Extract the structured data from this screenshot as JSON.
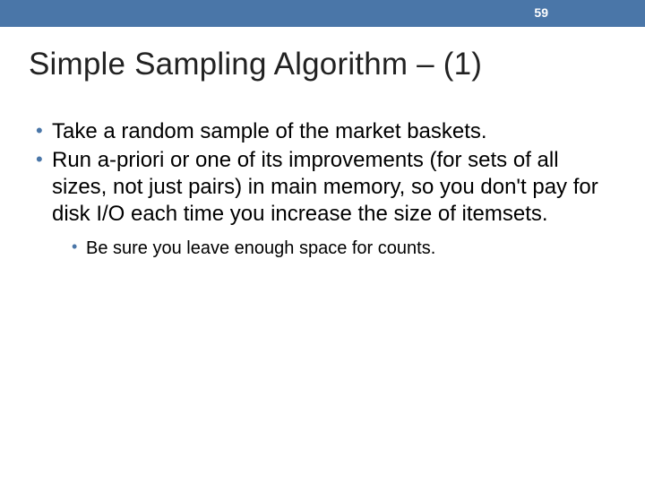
{
  "header": {
    "slide_number": "59"
  },
  "title": "Simple Sampling Algorithm – (1)",
  "bullets": [
    {
      "text": "Take a random sample of the market baskets."
    },
    {
      "text": "Run a-priori or one of its improvements (for sets of all sizes, not just pairs) in main memory, so you don't pay for disk I/O each time you increase the size of itemsets.",
      "sub": [
        {
          "text": "Be sure you leave enough space for counts."
        }
      ]
    }
  ]
}
